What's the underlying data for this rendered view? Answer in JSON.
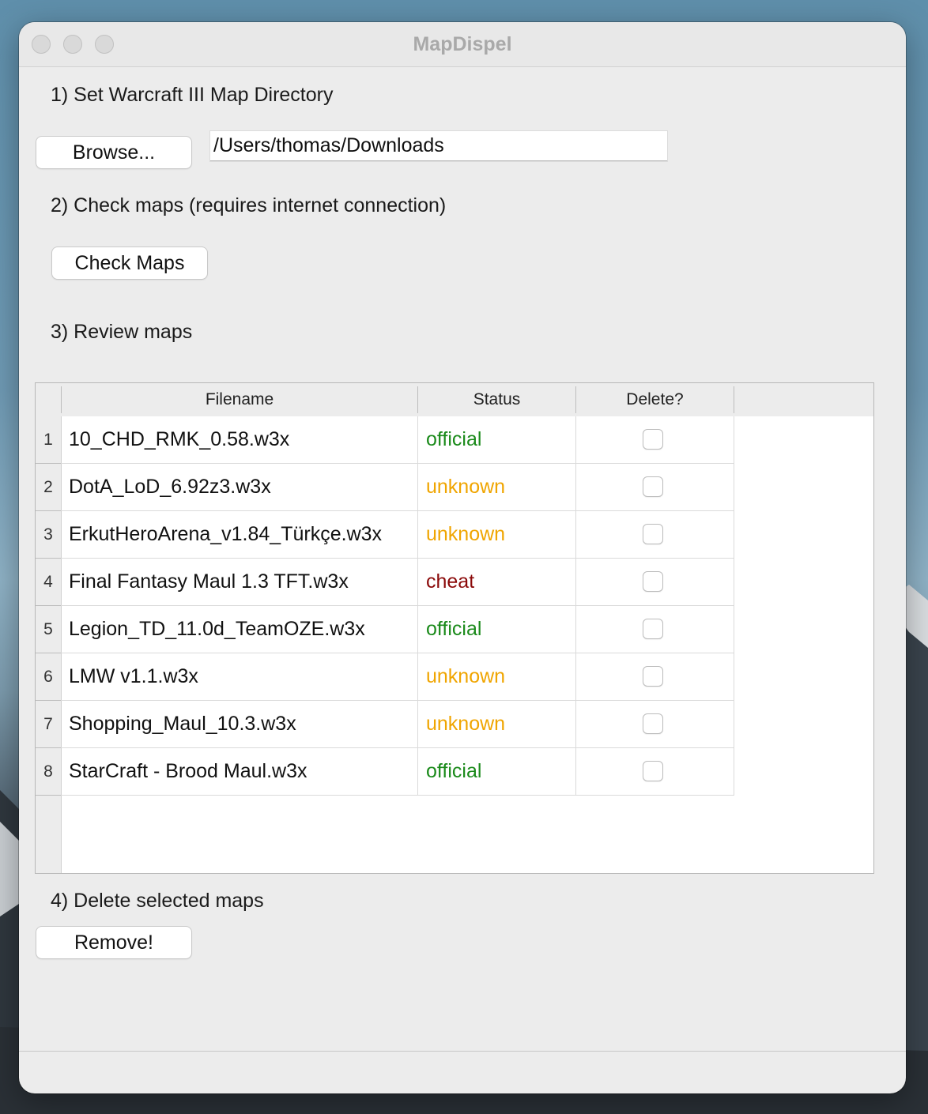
{
  "window": {
    "title": "MapDispel"
  },
  "step1": {
    "label": "1) Set Warcraft III Map Directory",
    "browse_label": "Browse...",
    "directory_value": "/Users/thomas/Downloads"
  },
  "step2": {
    "label": "2) Check maps (requires internet connection)",
    "check_label": "Check Maps"
  },
  "step3": {
    "label": "3) Review maps",
    "table": {
      "columns": [
        "Filename",
        "Status",
        "Delete?"
      ],
      "rows": [
        {
          "num": "1",
          "filename": "10_CHD_RMK_0.58.w3x",
          "status": "official",
          "delete": false
        },
        {
          "num": "2",
          "filename": "DotA_LoD_6.92z3.w3x",
          "status": "unknown",
          "delete": false
        },
        {
          "num": "3",
          "filename": "ErkutHeroArena_v1.84_Türkçe.w3x",
          "status": "unknown",
          "delete": false
        },
        {
          "num": "4",
          "filename": "Final Fantasy Maul 1.3 TFT.w3x",
          "status": "cheat",
          "delete": false
        },
        {
          "num": "5",
          "filename": "Legion_TD_11.0d_TeamOZE.w3x",
          "status": "official",
          "delete": false
        },
        {
          "num": "6",
          "filename": "LMW v1.1.w3x",
          "status": "unknown",
          "delete": false
        },
        {
          "num": "7",
          "filename": "Shopping_Maul_10.3.w3x",
          "status": "unknown",
          "delete": false
        },
        {
          "num": "8",
          "filename": "StarCraft - Brood Maul.w3x",
          "status": "official",
          "delete": false
        }
      ]
    }
  },
  "step4": {
    "label": "4) Delete selected maps",
    "remove_label": "Remove!"
  },
  "status_colors": {
    "official": "#1a8a1a",
    "unknown": "#f0a500",
    "cheat": "#8b0a0a"
  }
}
